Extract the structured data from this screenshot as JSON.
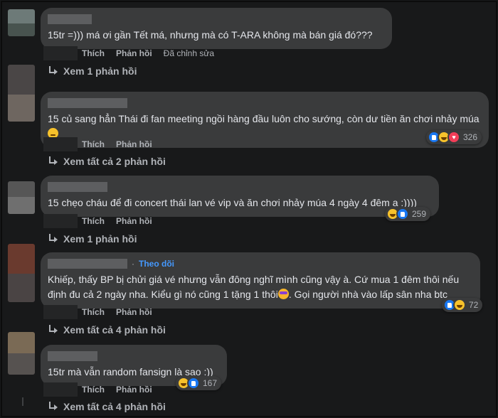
{
  "comments": [
    {
      "text": "15tr =))) má ơi gần Tết má, nhưng mà có T-ARA không mà bán giá đó???",
      "actions": {
        "like": "Thích",
        "reply": "Phản hồi",
        "edited": "Đã chỉnh sửa"
      },
      "replies": "Xem 1 phản hồi"
    },
    {
      "text": "15 củ sang hẳn Thái đi fan meeting ngồi hàng đầu luôn cho sướng, còn dư tiền ăn chơi nhảy múa",
      "actions": {
        "like": "Thích",
        "reply": "Phản hồi"
      },
      "reactions": {
        "icons": [
          "like-icon",
          "haha-icon",
          "love-icon"
        ],
        "count": "326"
      },
      "replies": "Xem tất cả 2 phản hồi"
    },
    {
      "text": "15 chẹo cháu để đi concert thái lan vé vip và ăn chơi nhảy múa 4 ngày 4 đêm ạ :))))",
      "actions": {
        "like": "Thích",
        "reply": "Phản hồi"
      },
      "reactions": {
        "icons": [
          "haha-icon",
          "like-icon"
        ],
        "count": "259"
      },
      "replies": "Xem 1 phản hồi"
    },
    {
      "follow": "Theo dõi",
      "separator": "·",
      "text_line1": "Khiếp, thấy BP bị chửi giá vé nhưng vẫn đông nghĩ mình cũng vậy à. Cứ mua 1 đêm thôi nếu",
      "text_line2": "định đu cả 2 ngày nha. Kiểu gì nó cũng 1 tặng 1 thôi",
      "text_line2b": ". Gọi người nhà vào lấp sân nha btc",
      "actions": {
        "like": "Thích",
        "reply": "Phản hồi"
      },
      "reactions": {
        "icons": [
          "like-icon",
          "haha-icon"
        ],
        "count": "72"
      },
      "replies": "Xem tất cả 4 phản hồi"
    },
    {
      "text": "15tr mà vẫn random fansign là sao :))",
      "actions": {
        "like": "Thích",
        "reply": "Phản hồi"
      },
      "reactions": {
        "icons": [
          "haha-icon",
          "like-icon"
        ],
        "count": "167"
      },
      "replies": "Xem tất cả 4 phản hồi"
    }
  ],
  "colors": {
    "background": "#18191a",
    "bubble": "#3a3b3c",
    "accent": "#4599ff",
    "like": "#1877f2"
  }
}
